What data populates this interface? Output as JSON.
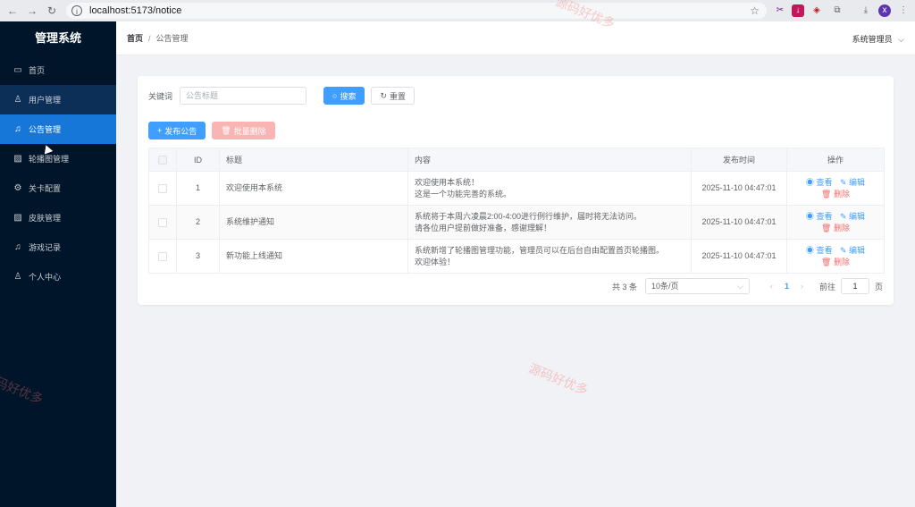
{
  "browser": {
    "url": "localhost:5173/notice"
  },
  "app": {
    "title": "管理系统"
  },
  "sidebar": {
    "items": [
      {
        "label": "首页",
        "icon": "dashboard-icon"
      },
      {
        "label": "用户管理",
        "icon": "user-icon"
      },
      {
        "label": "公告管理",
        "icon": "bell-icon"
      },
      {
        "label": "轮播图管理",
        "icon": "picture-icon"
      },
      {
        "label": "关卡配置",
        "icon": "gear-icon"
      },
      {
        "label": "皮肤管理",
        "icon": "picture-icon"
      },
      {
        "label": "游戏记录",
        "icon": "bell-icon"
      },
      {
        "label": "个人中心",
        "icon": "user-icon"
      }
    ]
  },
  "header": {
    "breadcrumb_home": "首页",
    "breadcrumb_current": "公告管理",
    "user": "系统管理员"
  },
  "search": {
    "label": "关键词",
    "placeholder": "公告标题",
    "search_button": "搜索",
    "reset_button": "重置"
  },
  "actions": {
    "publish": "发布公告",
    "batch_delete": "批量删除"
  },
  "table": {
    "columns": [
      "ID",
      "标题",
      "内容",
      "发布时间",
      "操作"
    ],
    "rows": [
      {
        "id": "1",
        "title": "欢迎使用本系统",
        "content_line1": "欢迎使用本系统！",
        "content_line2": "这是一个功能完善的系统。",
        "time": "2025-11-10 04:47:01"
      },
      {
        "id": "2",
        "title": "系统维护通知",
        "content_line1": "系统将于本周六凌晨2:00-4:00进行例行维护，届时将无法访问。",
        "content_line2": "请各位用户提前做好准备，感谢理解！",
        "time": "2025-11-10 04:47:01"
      },
      {
        "id": "3",
        "title": "新功能上线通知",
        "content_line1": "系统新增了轮播图管理功能，管理员可以在后台自由配置首页轮播图。",
        "content_line2": "欢迎体验！",
        "time": "2025-11-10 04:47:01"
      }
    ],
    "op_view": "查看",
    "op_edit": "编辑",
    "op_delete": "删除"
  },
  "pagination": {
    "total": "共 3 条",
    "page_size": "10条/页",
    "current_page": "1",
    "goto_label": "前往",
    "goto_value": "1",
    "page_suffix": "页"
  },
  "watermark": "源码好优多"
}
